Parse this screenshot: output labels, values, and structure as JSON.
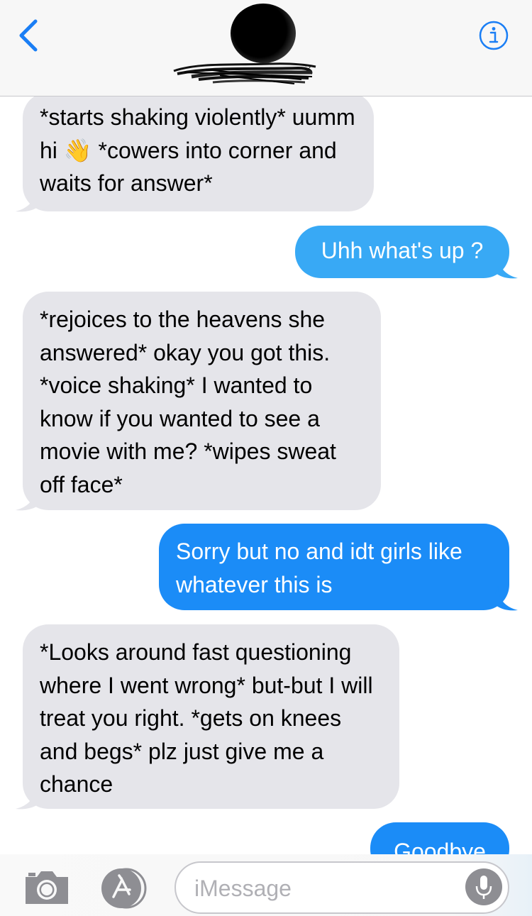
{
  "header": {
    "back_icon": "chevron-left-icon",
    "info_icon": "info-icon",
    "contact_name_visible": "?",
    "accent_color": "#1a7ef5"
  },
  "messages": [
    {
      "direction": "incoming",
      "text": "*starts shaking violently* uumm hi 👋 *cowers into corner and waits for answer*"
    },
    {
      "direction": "outgoing",
      "text": "Uhh what's up ?"
    },
    {
      "direction": "incoming",
      "text": "*rejoices to the heavens she answered* okay you got this. *voice shaking* I wanted to know if you wanted to see a movie with me? *wipes sweat off face*"
    },
    {
      "direction": "outgoing",
      "text": "Sorry but no and idt girls like whatever this is"
    },
    {
      "direction": "incoming",
      "text": "*Looks around fast questioning where I went wrong* but-but I will treat you right. *gets on knees and begs* plz just give me a chance"
    },
    {
      "direction": "outgoing",
      "text": "Goodbye"
    }
  ],
  "colors": {
    "incoming_bubble": "#e5e5ea",
    "outgoing_bubble": "#38a9f5",
    "outgoing_bubble_dark": "#1b8cf7"
  },
  "input_bar": {
    "camera_icon": "camera-icon",
    "appstore_icon": "app-store-icon",
    "placeholder": "iMessage",
    "mic_icon": "microphone-icon"
  }
}
